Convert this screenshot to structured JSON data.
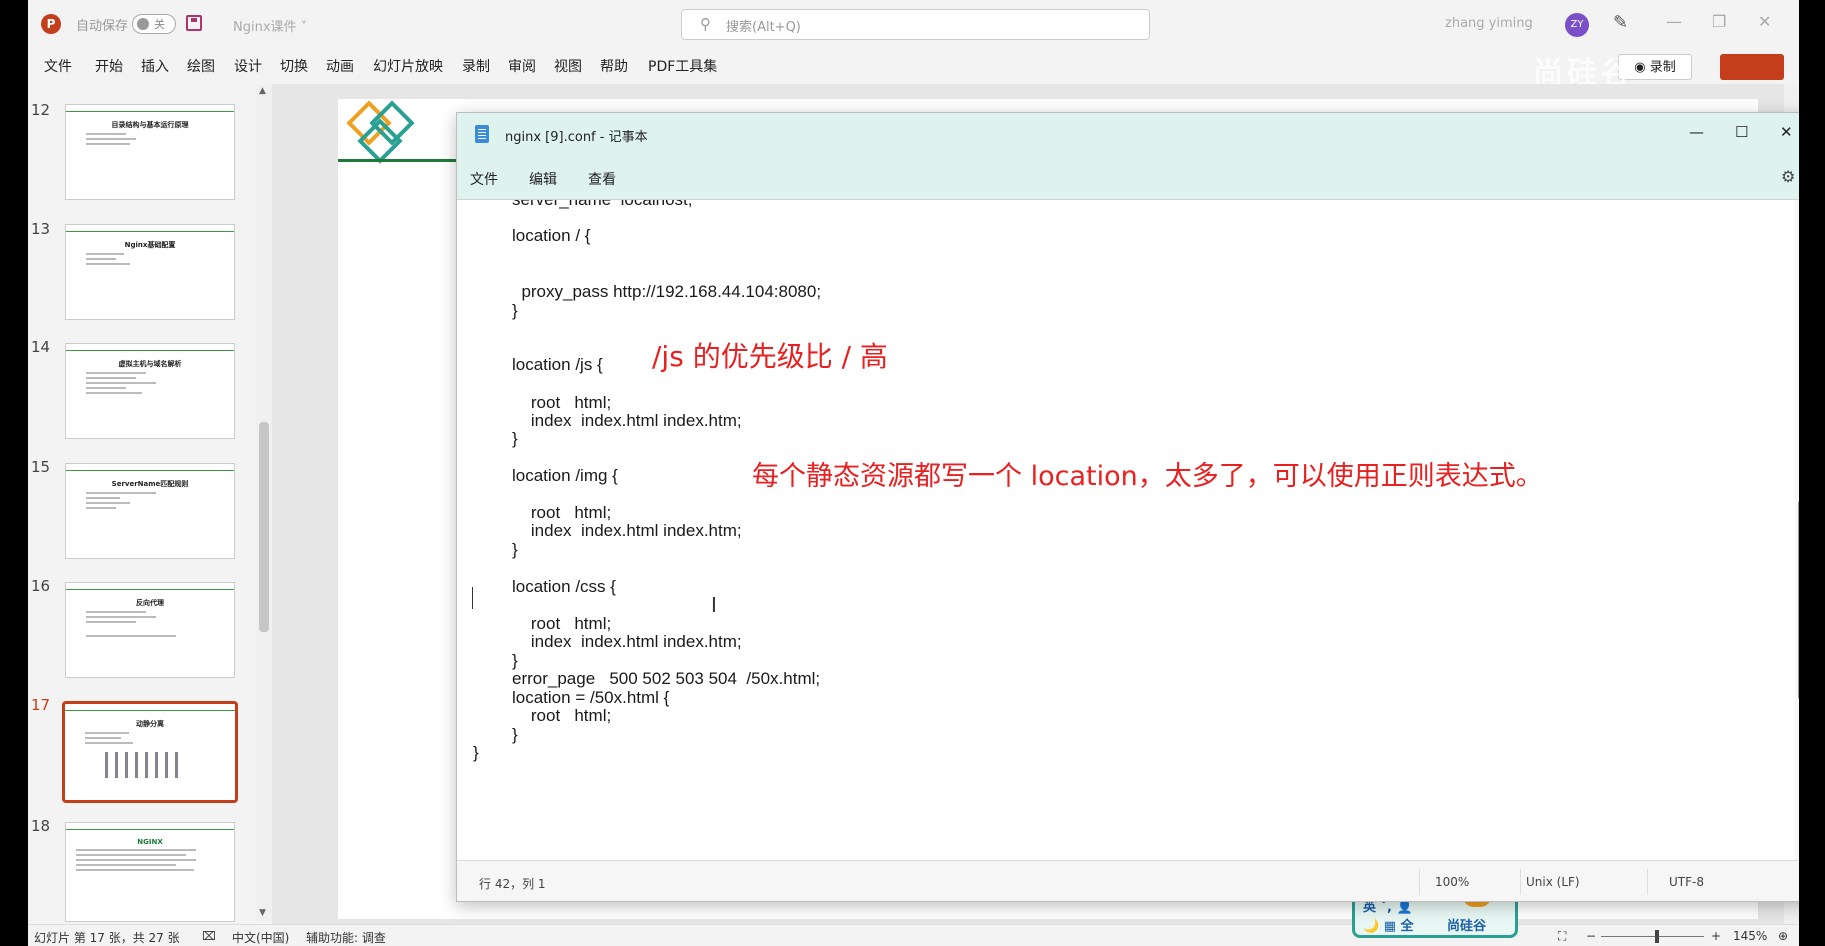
{
  "titlebar": {
    "app_icon": "P",
    "autosave_label": "自动保存",
    "autosave_state": "关",
    "doc_name": "Nginx课件 ˅",
    "search_placeholder": "搜索(Alt+Q)",
    "username": "zhang yiming",
    "avatar_initials": "ZY"
  },
  "ribbon": {
    "tabs": [
      "文件",
      "开始",
      "插入",
      "绘图",
      "设计",
      "切换",
      "动画",
      "幻灯片放映",
      "录制",
      "审阅",
      "视图",
      "帮助",
      "PDF工具集"
    ],
    "record_label": "◉ 录制",
    "watermark": "尚硅谷"
  },
  "thumbnails": [
    {
      "num": "12",
      "title": "目录结构与基本运行原理"
    },
    {
      "num": "13",
      "title": "Nginx基础配置"
    },
    {
      "num": "14",
      "title": "虚拟主机与域名解析"
    },
    {
      "num": "15",
      "title": "ServerName匹配规则"
    },
    {
      "num": "16",
      "title": "反向代理"
    },
    {
      "num": "17",
      "title": "动静分离"
    },
    {
      "num": "18",
      "title": "NGINX"
    }
  ],
  "statusbar": {
    "slide_info": "幻灯片 第 17 张，共 27 张",
    "language": "中文(中国)",
    "accessibility": "辅助功能: 调查",
    "zoom": "145%"
  },
  "brand": {
    "line1": "英 ˚, 👤",
    "line2": "🌙 ▦ 全",
    "name": "尚硅谷"
  },
  "notepad": {
    "title": "nginx [9].conf - 记事本",
    "menu": [
      "文件",
      "编辑",
      "查看"
    ],
    "code_lines": [
      "server_name  localhost;",
      "location / {",
      "  proxy_pass http://192.168.44.104:8080;",
      "}",
      "location /js {",
      "    root   html;",
      "    index  index.html index.htm;",
      "}",
      "location /img {",
      "    root   html;",
      "    index  index.html index.htm;",
      "}",
      "location /css {",
      "    root   html;",
      "    index  index.html index.htm;",
      "}",
      "error_page   500 502 503 504  /50x.html;",
      "location = /50x.html {",
      "    root   html;",
      "}",
      "}"
    ],
    "annotation_1": "/js 的优先级比 / 高",
    "annotation_2": "每个静态资源都写一个 location，太多了，可以使用正则表达式。",
    "status": {
      "position": "行 42，列 1",
      "zoom": "100%",
      "line_ending": "Unix (LF)",
      "encoding": "UTF-8"
    }
  },
  "colors": {
    "accent": "#c43e1c",
    "notepad_title_bg": "#dff3ee",
    "annotation": "#e82020",
    "brand_border": "#2aa093"
  }
}
